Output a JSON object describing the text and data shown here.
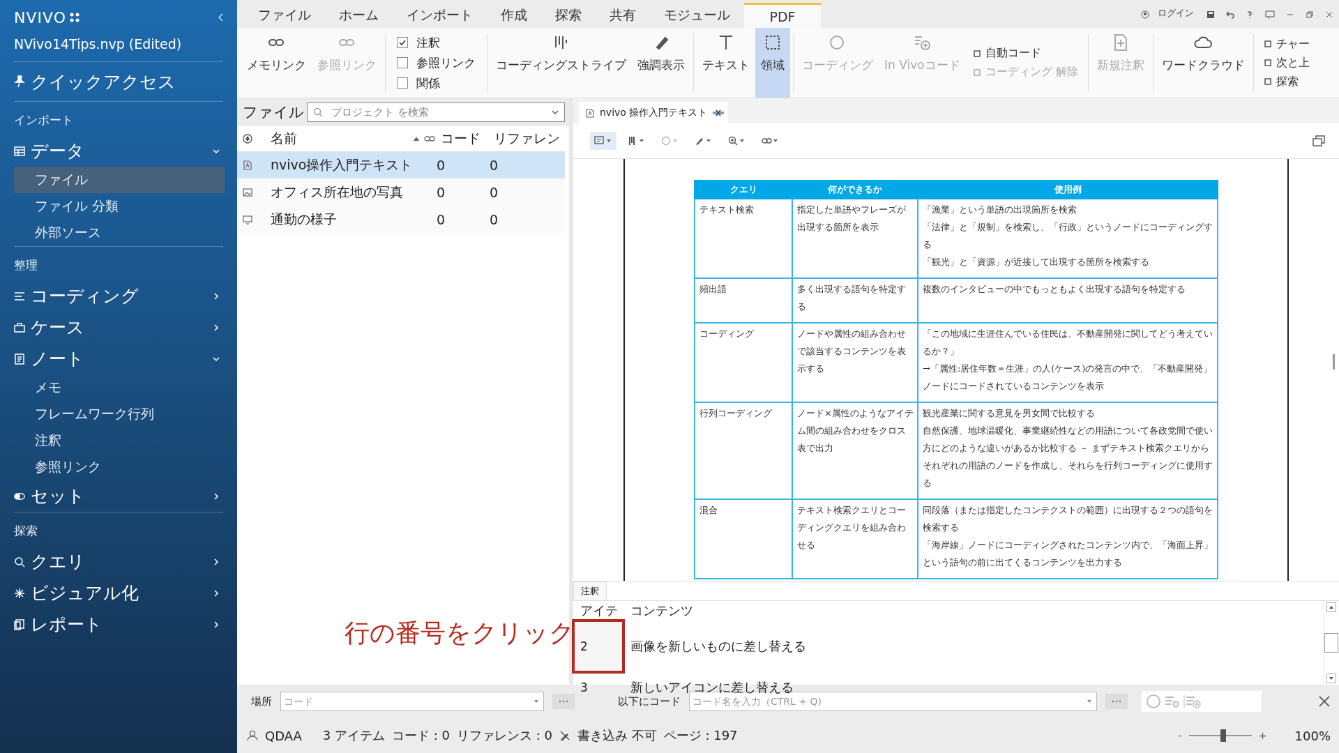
{
  "sidebar": {
    "logo": "NVIVO",
    "project": "NVivo14Tips.nvp (Edited)",
    "quick_access": "クイックアクセス",
    "sections": [
      {
        "title": "インポート",
        "items": [
          {
            "label": "データ",
            "expanded": true,
            "children": [
              {
                "label": "ファイル",
                "selected": true
              },
              {
                "label": "ファイル 分類",
                "selected": false
              },
              {
                "label": "外部ソース",
                "selected": false
              }
            ]
          }
        ]
      },
      {
        "title": "整理",
        "items": [
          {
            "label": "コーディング",
            "expanded": false
          },
          {
            "label": "ケース",
            "expanded": false
          },
          {
            "label": "ノート",
            "expanded": true,
            "children": [
              {
                "label": "メモ",
                "selected": false
              },
              {
                "label": "フレームワーク行列",
                "selected": false
              },
              {
                "label": "注釈",
                "selected": false
              },
              {
                "label": "参照リンク",
                "selected": false
              }
            ]
          },
          {
            "label": "セット",
            "expanded": false
          }
        ]
      },
      {
        "title": "探索",
        "items": [
          {
            "label": "クエリ",
            "expanded": false
          },
          {
            "label": "ビジュアル化",
            "expanded": false
          },
          {
            "label": "レポート",
            "expanded": false
          }
        ]
      }
    ]
  },
  "menu": {
    "tabs": [
      {
        "label": "ファイル",
        "selected": false
      },
      {
        "label": "ホーム",
        "selected": false
      },
      {
        "label": "インポート",
        "selected": false
      },
      {
        "label": "作成",
        "selected": false
      },
      {
        "label": "探索",
        "selected": false
      },
      {
        "label": "共有",
        "selected": false
      },
      {
        "label": "モジュール",
        "selected": false
      },
      {
        "label": "PDF",
        "selected": true
      }
    ],
    "login": "ログイン"
  },
  "ribbon": {
    "items": [
      {
        "kind": "large",
        "label": "メモリンク",
        "disabled": false,
        "selected": false
      },
      {
        "kind": "large",
        "label": "参照リンク",
        "disabled": true,
        "selected": false
      },
      {
        "kind": "checks",
        "options": [
          {
            "label": "注釈",
            "checked": true
          },
          {
            "label": "参照リンク",
            "checked": false
          },
          {
            "label": "関係",
            "checked": false
          }
        ]
      },
      {
        "kind": "large",
        "label": "コーディングストライプ",
        "disabled": false,
        "selected": false
      },
      {
        "kind": "large",
        "label": "強調表示",
        "disabled": false,
        "selected": false
      },
      {
        "kind": "large",
        "label": "テキスト",
        "disabled": false,
        "selected": false
      },
      {
        "kind": "large",
        "label": "領域",
        "disabled": false,
        "selected": true
      },
      {
        "kind": "large",
        "label": "コーディング",
        "disabled": true,
        "selected": false
      },
      {
        "kind": "large",
        "label": "In Vivoコード",
        "disabled": true,
        "selected": false
      },
      {
        "kind": "smalls",
        "options": [
          {
            "label": "自動コード",
            "disabled": false
          },
          {
            "label": "コーディング 解除",
            "disabled": true
          }
        ]
      },
      {
        "kind": "large",
        "label": "新規注釈",
        "disabled": true,
        "selected": false
      },
      {
        "kind": "large",
        "label": "ワードクラウド",
        "disabled": false,
        "selected": false
      },
      {
        "kind": "smalls",
        "options": [
          {
            "label": "チャー",
            "disabled": false
          },
          {
            "label": "次と上",
            "disabled": false
          },
          {
            "label": "探索",
            "disabled": false
          }
        ]
      }
    ]
  },
  "files": {
    "title": "ファイル",
    "search": {
      "placeholder": "プロジェクト を検索"
    },
    "columns": [
      "名前",
      "コード",
      "リファレン"
    ],
    "rows": [
      {
        "kind": "pdf",
        "name": "nvivo操作入門テキスト",
        "codes": "0",
        "references": "0",
        "selected": true
      },
      {
        "kind": "image",
        "name": "オフィス所在地の写真",
        "codes": "0",
        "references": "0",
        "selected": false
      },
      {
        "kind": "video",
        "name": "通勤の様子",
        "codes": "0",
        "references": "0",
        "selected": false
      }
    ]
  },
  "document": {
    "tab": "nvivo 操作入門テキスト",
    "pdf_table": {
      "columns": [
        "クエリ",
        "何ができるか",
        "使用例"
      ],
      "rows": [
        {
          "query": "テキスト検索",
          "purpose": "指定した単語やフレーズが出現する箇所を表示",
          "examples": [
            "「漁業」という単語の出現箇所を検索",
            "「法律」と「規制」を検索し、「行政」というノードにコーディングする",
            "「観光」と「資源」が近接して出現する箇所を検索する"
          ]
        },
        {
          "query": "頻出語",
          "purpose": "多く出現する語句を特定する",
          "examples": [
            "複数のインタビューの中でもっともよく出現する語句を特定する"
          ]
        },
        {
          "query": "コーディング",
          "purpose": "ノードや属性の組み合わせで該当するコンテンツを表示する",
          "examples": [
            "「この地域に生涯住んでいる住民は、不動産開発に関してどう考えているか？」",
            "→「属性:居住年数＝生涯」の人(ケース)の発言の中で、「不動産開発」ノードにコードされているコンテンツを表示"
          ]
        },
        {
          "query": "行列コーディング",
          "purpose": "ノード×属性のようなアイテム間の組み合わせをクロス表で出力",
          "examples": [
            "観光産業に関する意見を男女間で比較する",
            "自然保護、地球温暖化、事業継続性などの用語について各政党間で使い方にどのような違いがあるか比較する － まずテキスト検索クエリからそれぞれの用語のノードを作成し、それらを行列コーディングに使用する"
          ]
        },
        {
          "query": "混合",
          "purpose": "テキスト検索クエリとコーディングクエリを組み合わせる",
          "examples": [
            "同段落（または指定したコンテクストの範囲）に出現する２つの語句を検索する",
            "「海岸線」ノードにコーディングされたコンテンツ内で、「海面上昇」という語句の前に出てくるコンテンツを出力する"
          ]
        }
      ]
    }
  },
  "annotations": {
    "tab": "注釈",
    "columns": [
      "アイテ",
      "コンテンツ"
    ],
    "rows": [
      {
        "item": "2",
        "content": "画像を新しいものに差し替える"
      },
      {
        "item": "3",
        "content": "新しいアイコンに差し替える"
      }
    ],
    "callout": "行の番号をクリック"
  },
  "code_bar": {
    "location_label": "場所",
    "location": {
      "placeholder": "コード"
    },
    "code_label": "以下にコード",
    "code": {
      "placeholder": "コード名を入力（CTRL + Q)"
    }
  },
  "status_bar": {
    "user": "QDAA",
    "items": "3 アイテム",
    "codes": "コード : 0",
    "references": "リファレンス : 0",
    "write": "書き込み 不可",
    "page": "ページ : 197",
    "zoom_minus": "-",
    "zoom_plus": "+",
    "zoom": {
      "level": 0.55
    },
    "zoom_text": "100%"
  }
}
